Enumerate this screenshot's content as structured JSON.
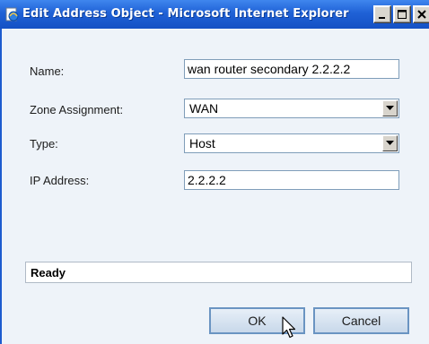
{
  "window": {
    "title": "Edit Address Object - Microsoft Internet Explorer",
    "icon": "ie-page-icon",
    "controls": [
      "minimize-icon",
      "maximize-icon",
      "close-icon"
    ]
  },
  "form": {
    "name_label": "Name:",
    "name_value": "wan router secondary 2.2.2.2",
    "zone_label": "Zone Assignment:",
    "zone_value": "WAN",
    "type_label": "Type:",
    "type_value": "Host",
    "ip_label": "IP Address:",
    "ip_value": "2.2.2.2"
  },
  "status": {
    "text": "Ready"
  },
  "buttons": {
    "ok_label": "OK",
    "cancel_label": "Cancel"
  },
  "colors": {
    "titlebar": "#1f61d6",
    "content_bg": "#eef3f9",
    "input_border": "#7f9db9",
    "button_border": "#6a94c2"
  }
}
